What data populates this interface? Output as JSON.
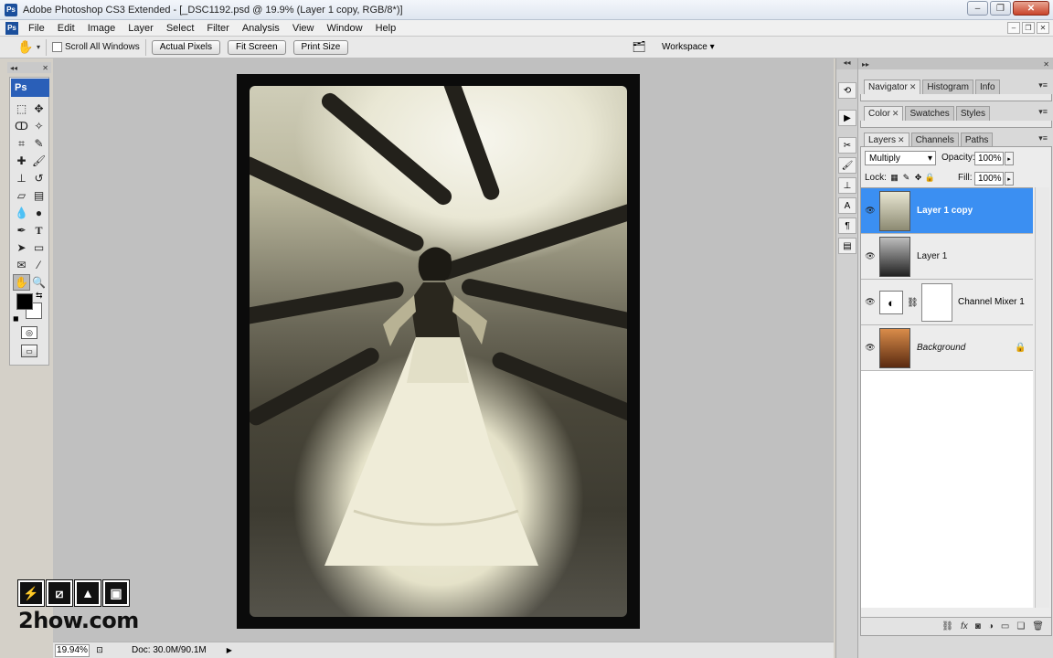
{
  "window": {
    "title": "Adobe Photoshop CS3 Extended - [_DSC1192.psd @ 19.9% (Layer 1 copy, RGB/8*)]",
    "minimize": "–",
    "maximize": "❐",
    "close": "✕"
  },
  "menu": {
    "items": [
      "File",
      "Edit",
      "Image",
      "Layer",
      "Select",
      "Filter",
      "Analysis",
      "View",
      "Window",
      "Help"
    ],
    "doc_minimize": "–",
    "doc_restore": "❐",
    "doc_close": "✕"
  },
  "options": {
    "scroll_all_windows": "Scroll All Windows",
    "actual_pixels": "Actual Pixels",
    "fit_screen": "Fit Screen",
    "print_size": "Print Size",
    "workspace": "Workspace ▾"
  },
  "tools": {
    "badge": "Ps"
  },
  "status": {
    "zoom": "19.94%",
    "doc": "Doc: 30.0M/90.1M"
  },
  "panels": {
    "group1_tabs": [
      "Navigator",
      "Histogram",
      "Info"
    ],
    "group2_tabs": [
      "Color",
      "Swatches",
      "Styles"
    ],
    "group3_tabs": [
      "Layers",
      "Channels",
      "Paths"
    ]
  },
  "layers": {
    "blend_mode": "Multiply",
    "opacity_label": "Opacity:",
    "opacity_value": "100%",
    "lock_label": "Lock:",
    "fill_label": "Fill:",
    "fill_value": "100%",
    "items": [
      {
        "name": "Layer 1 copy",
        "selected": true
      },
      {
        "name": "Layer 1",
        "selected": false
      },
      {
        "name": "Channel Mixer 1",
        "selected": false
      },
      {
        "name": "Background",
        "selected": false
      }
    ]
  },
  "watermark": {
    "text": "2how.com"
  }
}
